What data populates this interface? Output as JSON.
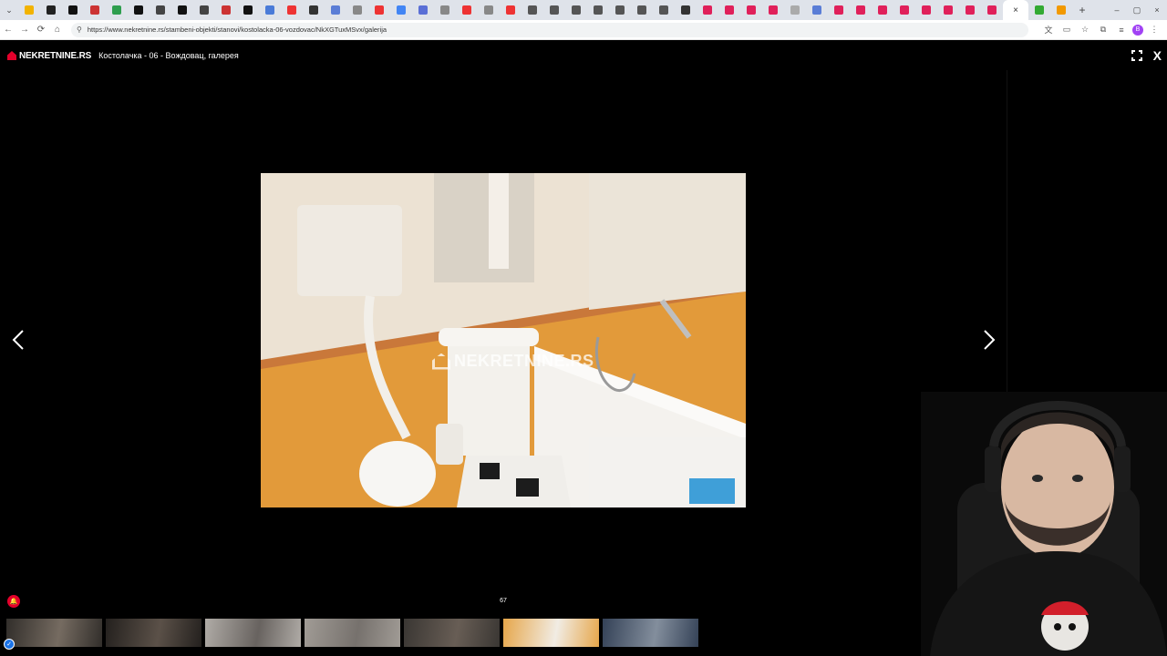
{
  "browser": {
    "tab_favicon_colors": [
      "#f2b300",
      "#222222",
      "#111111",
      "#c33",
      "#2e9e4e",
      "#111111",
      "#444444",
      "#111111",
      "#444444",
      "#c33",
      "#111111",
      "#4a7bd8",
      "#e33",
      "#333333",
      "#5a7dd6",
      "#888888",
      "#e33",
      "#4285f4",
      "#5a6fd6",
      "#888888",
      "#e33",
      "#888888",
      "#e33",
      "#555555",
      "#555555",
      "#555555",
      "#555555",
      "#555555",
      "#555555",
      "#555555",
      "#333333",
      "#e0205a",
      "#e0205a",
      "#e0205a",
      "#e0205a",
      "#aaaaaa",
      "#5a7dd6",
      "#e0205a",
      "#e0205a",
      "#e0205a",
      "#e0205a",
      "#e0205a",
      "#e0205a",
      "#e0205a",
      "#e0205a",
      "#33aa33",
      "#f29900"
    ],
    "active_tab_close": "×",
    "new_tab": "+",
    "window_controls": [
      "–",
      "▢",
      "×"
    ],
    "url": "https://www.nekretnine.rs/stambeni-objekti/stanovi/kostolacka-06-vozdovac/NkXGTuxMSvx/galerija",
    "profile_initial": "B"
  },
  "gallery": {
    "logo_text": "NEKRETNINE.RS",
    "title": "Костолачка - 06 - Вождовац, галерея",
    "counter": "67",
    "watermark": "NEKRETNINE.RS",
    "thumbnail_count": 7,
    "current_thumbnail": 5
  }
}
